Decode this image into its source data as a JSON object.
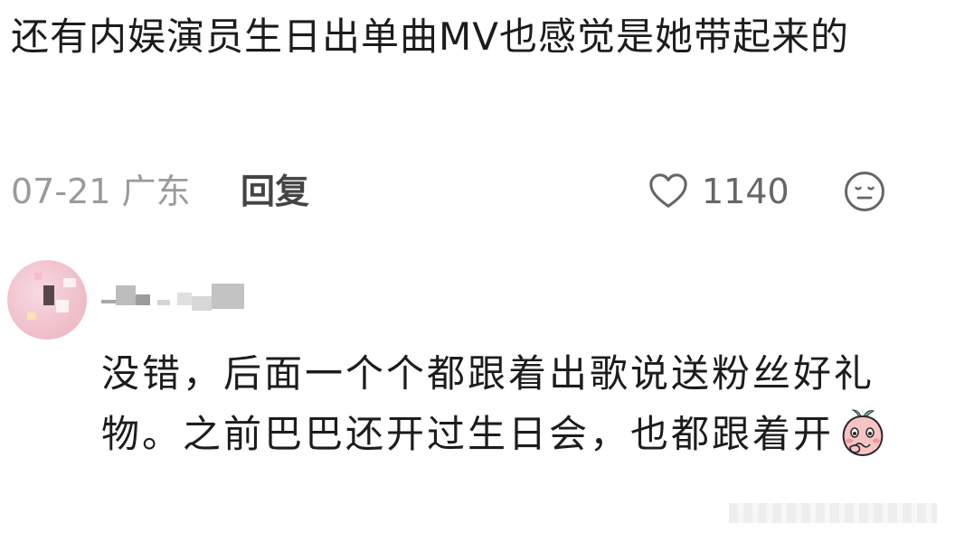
{
  "comment": {
    "text": "还有内娱演员生日出单曲MV也感觉是她带起来的",
    "date_location": "07-21 广东",
    "reply_label": "回复",
    "like_count": "1140",
    "heart_icon": "heart-outline-icon",
    "react_icon": "neutral-face-icon"
  },
  "reply": {
    "avatar_icon": "user-avatar",
    "text": "没错，后面一个个都跟着出歌说送粉丝好礼物。之前巴巴还开过生日会，也都跟着开",
    "trailing_emoji": "shy-peach-emoji"
  },
  "colors": {
    "text_primary": "#1c1c1c",
    "text_meta": "#9a9a9a",
    "reply_link": "#444444",
    "like_count": "#666666",
    "avatar_bg": "#f0c2cc"
  }
}
